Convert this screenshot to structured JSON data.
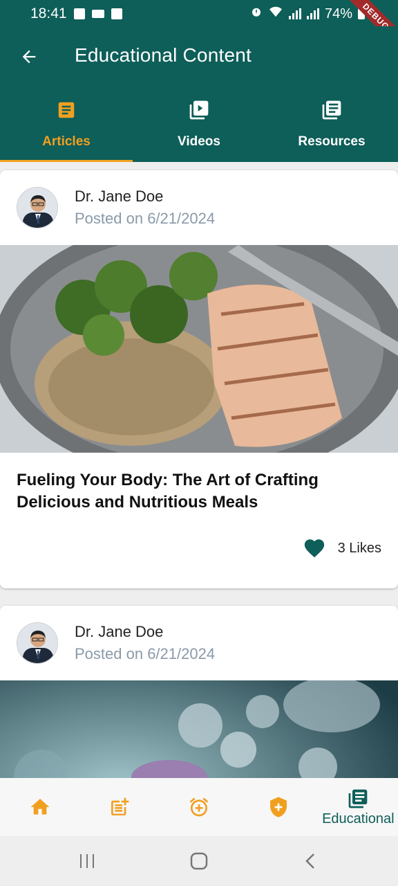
{
  "status_bar": {
    "time": "18:41",
    "battery": "74%",
    "debug_label": "DEBUG"
  },
  "app_bar": {
    "title": "Educational Content"
  },
  "tabs": [
    {
      "label": "Articles",
      "icon": "article-icon",
      "active": true
    },
    {
      "label": "Videos",
      "icon": "video-library-icon",
      "active": false
    },
    {
      "label": "Resources",
      "icon": "library-books-icon",
      "active": false
    }
  ],
  "articles": [
    {
      "author": "Dr. Jane Doe",
      "posted": "Posted on 6/21/2024",
      "title": "Fueling Your Body: The Art of Crafting Delicious and Nutritious Meals",
      "likes": "3 Likes",
      "image": "salmon-rice-broccoli-plate"
    },
    {
      "author": "Dr. Jane Doe",
      "posted": "Posted on 6/21/2024",
      "image": "cells-microscope"
    }
  ],
  "bottom_nav": {
    "items": [
      {
        "icon": "home-icon"
      },
      {
        "icon": "post-add-icon"
      },
      {
        "icon": "alarm-add-icon"
      },
      {
        "icon": "health-shield-icon"
      },
      {
        "icon": "library-books-icon",
        "label": "Educational",
        "active": true
      }
    ]
  },
  "colors": {
    "primary": "#0e5e59",
    "accent": "#f0a020",
    "muted": "#8a9aa8"
  }
}
